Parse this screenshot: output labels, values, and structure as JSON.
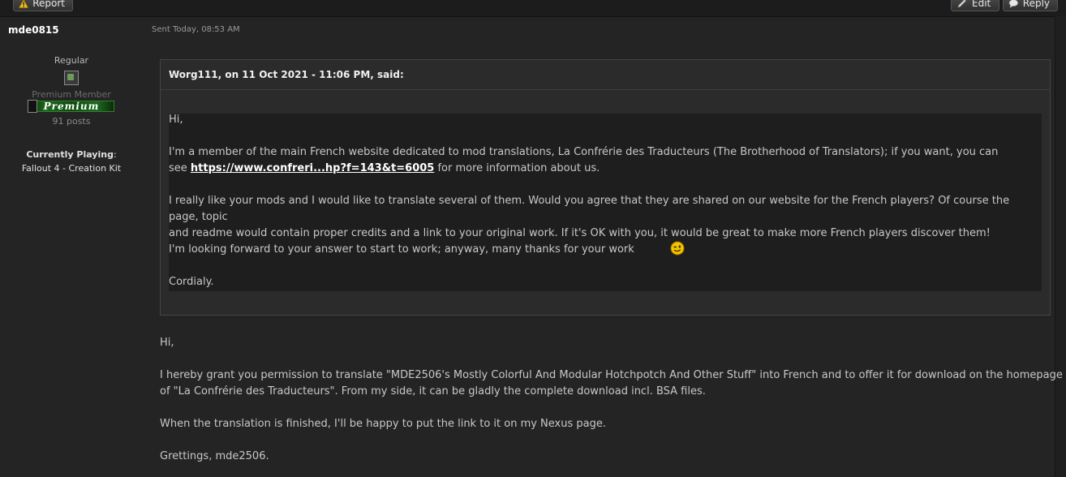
{
  "toolbar": {
    "report_label": "Report",
    "edit_label": "Edit",
    "reply_label": "Reply"
  },
  "post": {
    "author": "mde0815",
    "sent": "Sent Today, 08:53 AM"
  },
  "author_info": {
    "rank": "Regular",
    "member_type": "Premium Member",
    "badge_text": "Premium",
    "posts": "91 posts",
    "playing_label": "Currently Playing",
    "playing_game": "Fallout 4 - Creation Kit"
  },
  "quote": {
    "header": "Worg111, on 11 Oct 2021 - 11:06 PM, said:",
    "greeting": "Hi,",
    "para1_line1": "I'm a member of the main French website dedicated to mod translations, La Confrérie des Traducteurs (The Brotherhood of Translators); if you want, you can",
    "para1_prefix": "see ",
    "para1_link": "https://www.confreri...hp?f=143&t=6005",
    "para1_suffix": " for more information about us.",
    "para2_line1": "I really like your mods and I would like to translate several of them. Would you agree that they are shared on our website for the French players? Of course the page, topic",
    "para2_line2": "and readme would contain proper credits and a link to your original work. If it's OK with you, it would be great to make more French players discover them!",
    "para3": "I'm looking forward to your answer to start to work; anyway, many thanks for your work",
    "closing": "Cordialy."
  },
  "reply": {
    "greeting": "Hi,",
    "para1_line1": "I hereby grant you permission to translate \"MDE2506's Mostly Colorful And Modular Hotchpotch And Other Stuff\" into French and to offer it for download on the homepage",
    "para1_line2": "of \"La Confrérie des Traducteurs\". From my side, it can be gladly the complete download incl. BSA files.",
    "para2": "When the translation is finished, I'll be happy to put the link to it on my Nexus page.",
    "signoff": "Grettings, mde2506."
  }
}
